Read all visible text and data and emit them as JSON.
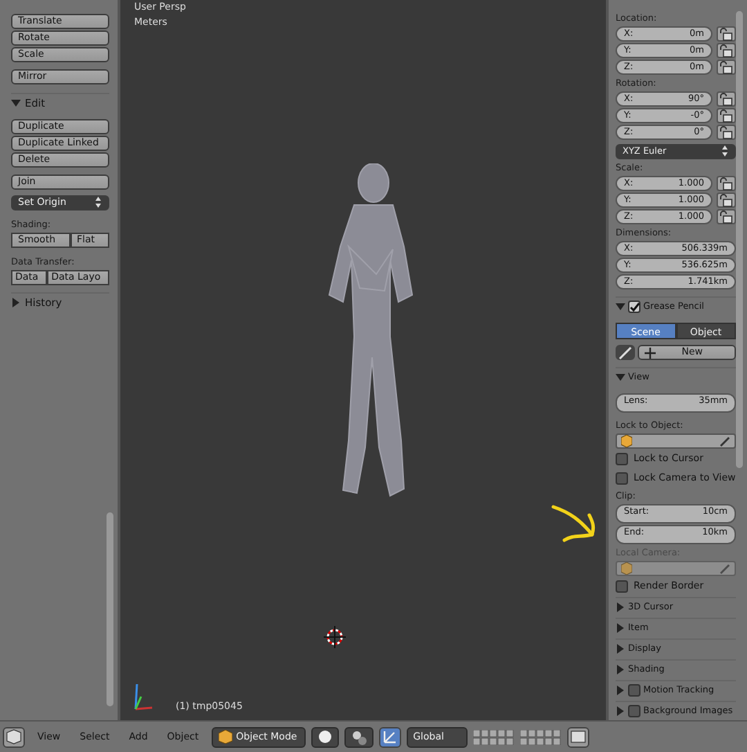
{
  "viewport": {
    "view_name": "User Persp",
    "units": "Meters",
    "object_label": "(1) tmp05045"
  },
  "tool_shelf": {
    "transform_buttons": [
      "Translate",
      "Rotate",
      "Scale"
    ],
    "mirror_button": "Mirror",
    "edit_panel": {
      "title": "Edit",
      "expanded": true,
      "buttons": [
        "Duplicate",
        "Duplicate Linked",
        "Delete"
      ],
      "join_button": "Join",
      "set_origin": "Set Origin",
      "shading_label": "Shading:",
      "shading_buttons": [
        "Smooth",
        "Flat"
      ],
      "data_transfer_label": "Data Transfer:",
      "data_transfer_buttons": [
        "Data",
        "Data Layo"
      ]
    },
    "history_panel": {
      "title": "History",
      "expanded": false
    }
  },
  "properties": {
    "location": {
      "label": "Location:",
      "fields": [
        {
          "axis": "X:",
          "value": "0m"
        },
        {
          "axis": "Y:",
          "value": "0m"
        },
        {
          "axis": "Z:",
          "value": "0m"
        }
      ]
    },
    "rotation": {
      "label": "Rotation:",
      "fields": [
        {
          "axis": "X:",
          "value": "90°"
        },
        {
          "axis": "Y:",
          "value": "-0°"
        },
        {
          "axis": "Z:",
          "value": "0°"
        }
      ]
    },
    "rotation_mode": "XYZ Euler",
    "scale": {
      "label": "Scale:",
      "fields": [
        {
          "axis": "X:",
          "value": "1.000"
        },
        {
          "axis": "Y:",
          "value": "1.000"
        },
        {
          "axis": "Z:",
          "value": "1.000"
        }
      ]
    },
    "dimensions": {
      "label": "Dimensions:",
      "fields": [
        {
          "axis": "X:",
          "value": "506.339m"
        },
        {
          "axis": "Y:",
          "value": "536.625m"
        },
        {
          "axis": "Z:",
          "value": "1.741km"
        }
      ]
    },
    "grease_pencil": {
      "title": "Grease Pencil",
      "expanded": true,
      "enabled": true,
      "tabs": [
        {
          "label": "Scene",
          "selected": true
        },
        {
          "label": "Object",
          "selected": false
        }
      ],
      "new_button": "New"
    },
    "view": {
      "title": "View",
      "expanded": true,
      "lens_label": "Lens:",
      "lens_value": "35mm",
      "lock_to_object_label": "Lock to Object:",
      "checkboxes": [
        {
          "label": "Lock to Cursor",
          "checked": false
        },
        {
          "label": "Lock Camera to View",
          "checked": false
        }
      ],
      "clip_label": "Clip:",
      "clip": [
        {
          "label": "Start:",
          "value": "10cm"
        },
        {
          "label": "End:",
          "value": "10km"
        }
      ],
      "local_camera_label": "Local Camera:",
      "local_camera_disabled": true,
      "render_border": {
        "label": "Render Border",
        "checked": false
      }
    },
    "collapsed_panels": [
      {
        "title": "3D Cursor",
        "kind": "plain",
        "expanded": false
      },
      {
        "title": "Item",
        "kind": "plain",
        "expanded": false
      },
      {
        "title": "Display",
        "kind": "plain",
        "expanded": false
      },
      {
        "title": "Shading",
        "kind": "plain",
        "expanded": false
      },
      {
        "title": "Motion Tracking",
        "kind": "toggle",
        "expanded": false,
        "checked": false
      },
      {
        "title": "Background Images",
        "kind": "toggle",
        "expanded": false,
        "checked": false
      }
    ]
  },
  "header": {
    "menus": [
      "View",
      "Select",
      "Add",
      "Object"
    ],
    "mode": "Object Mode",
    "orientation": "Global"
  }
}
